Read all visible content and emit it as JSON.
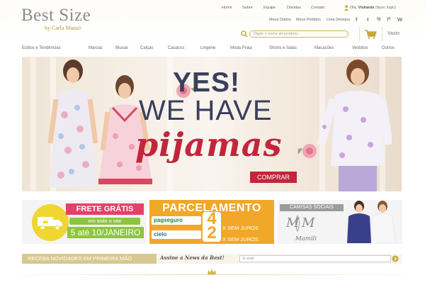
{
  "brand": {
    "name": "Best Size",
    "byline": "by Carla Mansó"
  },
  "topnav": [
    "Home",
    "Sobre",
    "Equipe",
    "Dúvidas",
    "Contato"
  ],
  "account": {
    "greeting": "Olá,",
    "user": "Visitante",
    "login": "(fazer login)"
  },
  "subnav": [
    "Meus Dados",
    "Meus Pedidos",
    "Lista Desejos"
  ],
  "social": [
    "f",
    "t",
    "ig",
    "yt",
    "W"
  ],
  "search": {
    "placeholder": "Digite o nome do produto..."
  },
  "cart": {
    "label": "Vazio"
  },
  "categories": [
    "Estilos e Tendências",
    "Marcas",
    "Blusas",
    "Calças",
    "Casacos",
    "Lingerie",
    "Moda Praia",
    "Shorts e Saias",
    "Macacões",
    "Vestidos",
    "Outros"
  ],
  "hero": {
    "line1": "YES!",
    "line2": "WE HAVE",
    "line3": "pijamas",
    "button": "COMPRAR",
    "slide_count": 4,
    "active_slide": 3
  },
  "promo_frete": {
    "title": "FRETE GRÁTIS",
    "subtitle": "em todo o site",
    "date": "5 até 10/JANEIRO"
  },
  "promo_parcelamento": {
    "title": "PARCELAMENTO",
    "provider1": "pagseguro",
    "provider2": "cielo",
    "n1": "4",
    "n2": "2",
    "label": "X SEM JUROS",
    "suffix1": "X SEM JUROS",
    "suffix2": "X SEM JUROS"
  },
  "promo_camisas": {
    "title": "CAMISAS SOCIAIS",
    "brand": "Mamili"
  },
  "newsletter": {
    "label": "RECEBA NOVIDADES EM PRIMEIRA MÃO",
    "cta": "Assine a News da Best!",
    "placeholder": "E-mail"
  },
  "colors": {
    "gold": "#c9a638",
    "red": "#c3253c",
    "navy": "#3b3f5c",
    "orange": "#f1a727",
    "pink": "#e5406a",
    "green": "#8cc63f",
    "yellow": "#efd631"
  }
}
